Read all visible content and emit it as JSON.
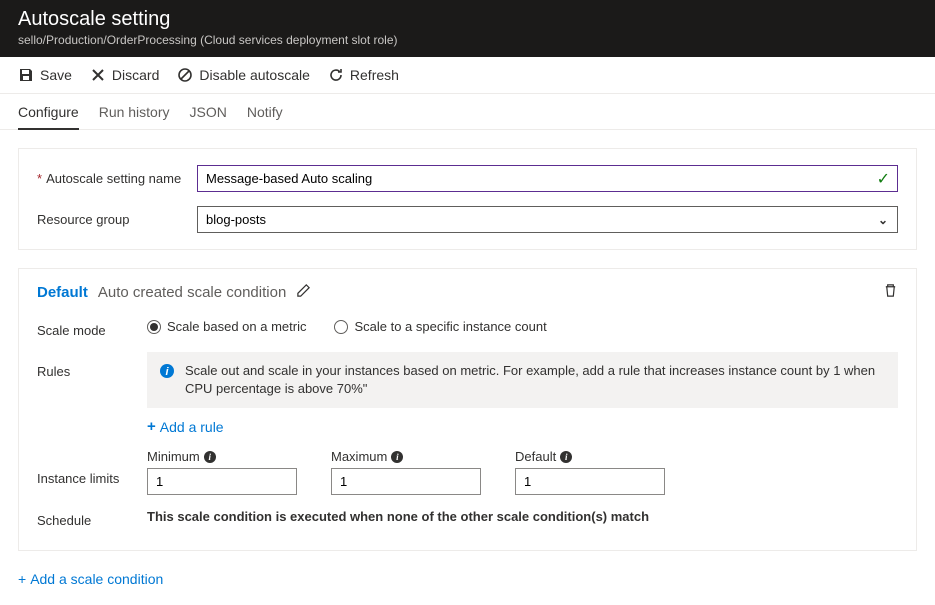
{
  "header": {
    "title": "Autoscale setting",
    "subtitle": "sello/Production/OrderProcessing (Cloud services deployment slot role)"
  },
  "toolbar": {
    "save": "Save",
    "discard": "Discard",
    "disable": "Disable autoscale",
    "refresh": "Refresh"
  },
  "tabs": {
    "configure": "Configure",
    "run_history": "Run history",
    "json": "JSON",
    "notify": "Notify"
  },
  "fields": {
    "name_label": "Autoscale setting name",
    "name_value": "Message-based Auto scaling",
    "rg_label": "Resource group",
    "rg_value": "blog-posts"
  },
  "condition": {
    "default_label": "Default",
    "subtitle": "Auto created scale condition",
    "scale_mode": {
      "label": "Scale mode",
      "opt_metric": "Scale based on a metric",
      "opt_count": "Scale to a specific instance count"
    },
    "rules": {
      "label": "Rules",
      "info": "Scale out and scale in your instances based on metric. For example, add a rule that increases instance count by 1 when CPU percentage is above 70%\"",
      "add": "Add a rule"
    },
    "limits": {
      "label": "Instance limits",
      "min_label": "Minimum",
      "min_value": "1",
      "max_label": "Maximum",
      "max_value": "1",
      "def_label": "Default",
      "def_value": "1"
    },
    "schedule": {
      "label": "Schedule",
      "text": "This scale condition is executed when none of the other scale condition(s) match"
    }
  },
  "footer": {
    "add_condition": "Add a scale condition"
  }
}
